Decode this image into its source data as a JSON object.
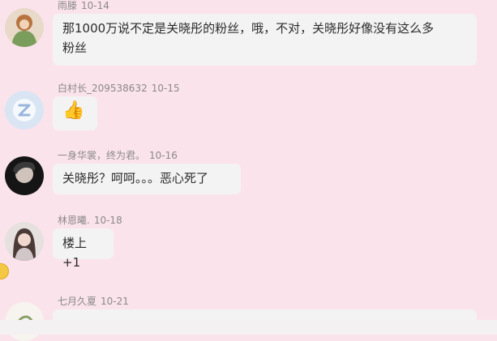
{
  "comments": [
    {
      "username": "雨滕",
      "time": "10-14",
      "text_line1": "那1000万说不定是关晓彤的粉丝，哦，不对，关晓彤好像没有这么多",
      "text_line2": "粉丝"
    },
    {
      "username": "白村长_209538632",
      "time": "10-15",
      "text": "👍"
    },
    {
      "username": "一身华裳，终为君。",
      "time": "10-16",
      "text": "关晓彤？呵呵。。。恶心死了"
    },
    {
      "username": "林恩曦.",
      "time": "10-18",
      "text": "楼上+1"
    },
    {
      "username": "七月久夏",
      "time": "10-21",
      "text": ""
    }
  ],
  "colors": {
    "background": "#fbe3ec",
    "bubble": "#f4f3f4",
    "meta_text": "#8a8a8a",
    "body_text": "#2b2b2b"
  },
  "icons": {
    "thumbs_up": "thumbs-up-emoji-icon",
    "floating": "emoji-float-icon"
  }
}
